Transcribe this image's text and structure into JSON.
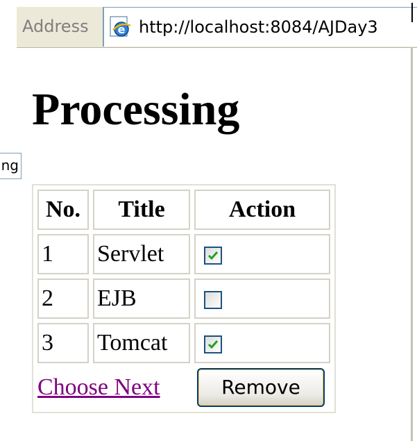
{
  "address_bar": {
    "label": "Address",
    "url": "http://localhost:8084/AJDay3"
  },
  "fragment_text": "ng",
  "heading": "Processing",
  "table": {
    "headers": [
      "No.",
      "Title",
      "Action"
    ],
    "rows": [
      {
        "no": "1",
        "title": "Servlet",
        "checked": true
      },
      {
        "no": "2",
        "title": "EJB",
        "checked": false
      },
      {
        "no": "3",
        "title": "Tomcat",
        "checked": true
      }
    ],
    "link_label": "Choose Next",
    "button_label": "Remove"
  },
  "colors": {
    "link_visited": "#800080",
    "checkbox_border": "#1c5180",
    "checkmark": "#21a121",
    "button_border": "#003c74"
  },
  "icons": {
    "page_icon": "ie-page-icon",
    "checkmark": "checkmark-icon"
  }
}
